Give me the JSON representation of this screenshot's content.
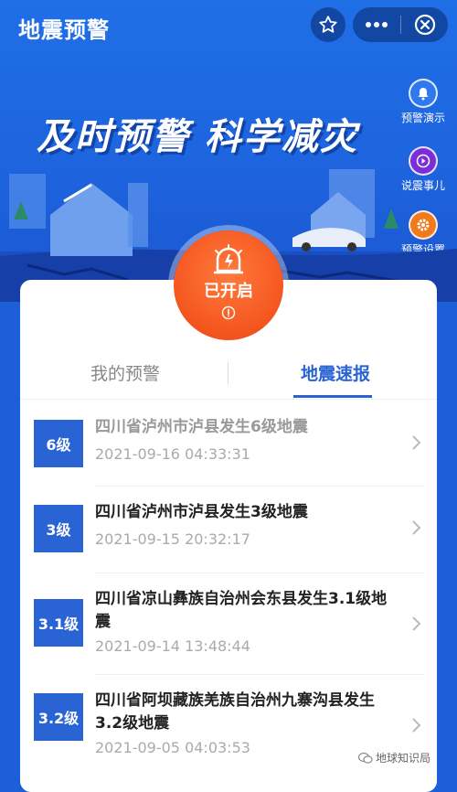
{
  "header": {
    "title": "地震预警"
  },
  "banner": {
    "slogan": "及时预警 科学减灾"
  },
  "side_buttons": [
    {
      "label": "预警演示",
      "icon": "bell-icon",
      "color": "#2f78f0"
    },
    {
      "label": "说震事儿",
      "icon": "play-icon",
      "color": "#7a2fd6"
    },
    {
      "label": "预警设置",
      "icon": "gear-icon",
      "color": "#f07a1c"
    }
  ],
  "status": {
    "label": "已开启",
    "color": "#f4551e"
  },
  "tabs": [
    {
      "label": "我的预警",
      "active": false
    },
    {
      "label": "地震速报",
      "active": true
    }
  ],
  "reports": [
    {
      "magnitude": "6级",
      "title": "四川省泸州市泸县发生6级地震",
      "time": "2021-09-16 04:33:31"
    },
    {
      "magnitude": "3级",
      "title": "四川省泸州市泸县发生3级地震",
      "time": "2021-09-15 20:32:17"
    },
    {
      "magnitude": "3.1级",
      "title": "四川省凉山彝族自治州会东县发生3.1级地震",
      "time": "2021-09-14 13:48:44"
    },
    {
      "magnitude": "3.2级",
      "title": "四川省阿坝藏族羌族自治州九寨沟县发生3.2级地震",
      "time": "2021-09-05 04:03:53"
    }
  ],
  "watermark": {
    "text": "地球知识局"
  },
  "colors": {
    "accent": "#2a63d4",
    "hero": "#1f6fe6"
  }
}
